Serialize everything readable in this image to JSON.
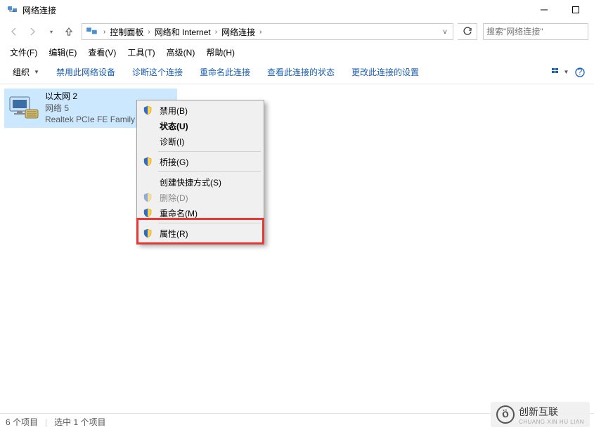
{
  "window": {
    "title": "网络连接"
  },
  "breadcrumbs": {
    "b1": "控制面板",
    "b2": "网络和 Internet",
    "b3": "网络连接"
  },
  "search": {
    "placeholder": "搜索\"网络连接\""
  },
  "menubar": {
    "m0": "文件(F)",
    "m1": "编辑(E)",
    "m2": "查看(V)",
    "m3": "工具(T)",
    "m4": "高级(N)",
    "m5": "帮助(H)"
  },
  "cmdbar": {
    "organize": "组织",
    "c1": "禁用此网络设备",
    "c2": "诊断这个连接",
    "c3": "重命名此连接",
    "c4": "查看此连接的状态",
    "c5": "更改此连接的设置"
  },
  "adapter": {
    "name": "以太网 2",
    "status": "网络  5",
    "device": "Realtek PCIe FE Family"
  },
  "ctx": {
    "disable": "禁用(B)",
    "status": "状态(U)",
    "diagnose": "诊断(I)",
    "bridge": "桥接(G)",
    "shortcut": "创建快捷方式(S)",
    "delete": "删除(D)",
    "rename": "重命名(M)",
    "properties": "属性(R)"
  },
  "statusbar": {
    "s1": "6 个项目",
    "s2": "选中 1 个项目"
  },
  "watermark": {
    "brand": "创新互联",
    "sub": "CHUANG XIN HU LIAN"
  }
}
